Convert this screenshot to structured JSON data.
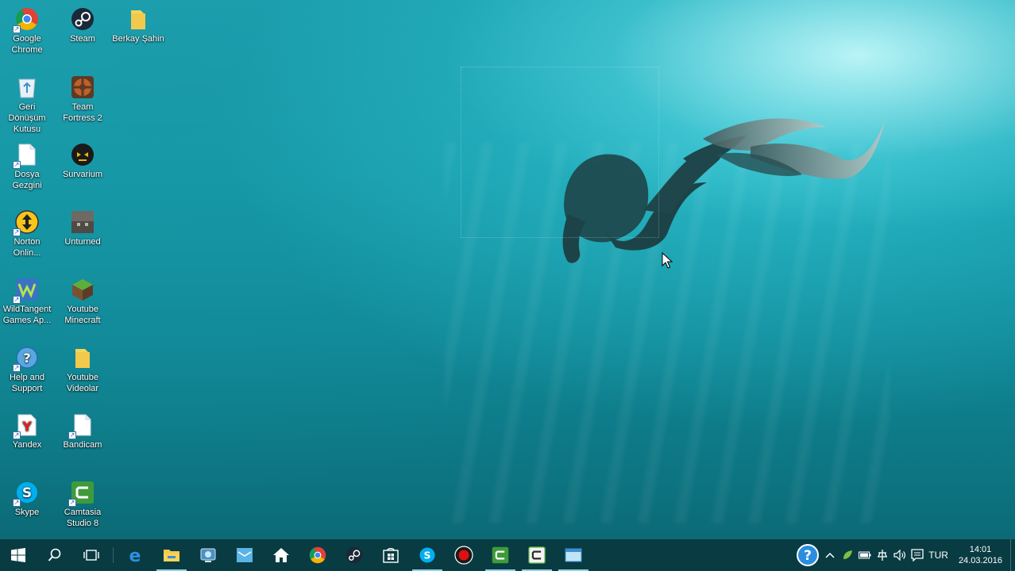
{
  "desktop": {
    "icons": [
      {
        "name": "google-chrome",
        "label": "Google Chrome",
        "icon": "chrome-icon"
      },
      {
        "name": "steam",
        "label": "Steam",
        "icon": "steam-icon"
      },
      {
        "name": "berkay-sahin",
        "label": "Berkay Şahin",
        "icon": "folder-icon"
      },
      {
        "name": "recycle-bin",
        "label": "Geri Dönüşüm Kutusu",
        "icon": "recycle-bin-icon"
      },
      {
        "name": "team-fortress-2",
        "label": "Team Fortress 2",
        "icon": "tf2-icon"
      },
      {
        "name": "file-explorer",
        "label": "Dosya Gezgini",
        "icon": "file-icon"
      },
      {
        "name": "survarium",
        "label": "Survarium",
        "icon": "survarium-icon"
      },
      {
        "name": "norton",
        "label": "Norton Onlin...",
        "icon": "norton-icon"
      },
      {
        "name": "unturned",
        "label": "Unturned",
        "icon": "unturned-icon"
      },
      {
        "name": "wildtangent",
        "label": "WildTangent Games Ap...",
        "icon": "wildtangent-icon"
      },
      {
        "name": "youtube-minecraft",
        "label": "Youtube Minecraft",
        "icon": "minecraft-icon"
      },
      {
        "name": "help-and-support",
        "label": "Help and Support",
        "icon": "help-icon"
      },
      {
        "name": "youtube-videolar",
        "label": "Youtube Videolar",
        "icon": "folder-icon"
      },
      {
        "name": "yandex",
        "label": "Yandex",
        "icon": "yandex-icon"
      },
      {
        "name": "bandicam",
        "label": "Bandicam",
        "icon": "file-icon"
      },
      {
        "name": "skype",
        "label": "Skype",
        "icon": "skype-icon"
      },
      {
        "name": "camtasia",
        "label": "Camtasia Studio 8",
        "icon": "camtasia-icon"
      }
    ]
  },
  "taskbar": {
    "apps": [
      {
        "name": "start",
        "icon": "windows-start-icon"
      },
      {
        "name": "search",
        "icon": "search-icon"
      },
      {
        "name": "task-view",
        "icon": "task-view-icon"
      },
      {
        "name": "edge",
        "icon": "edge-icon"
      },
      {
        "name": "file-explorer",
        "icon": "folder-icon"
      },
      {
        "name": "control-panel",
        "icon": "control-panel-icon"
      },
      {
        "name": "mail",
        "icon": "mail-icon"
      },
      {
        "name": "home",
        "icon": "home-icon"
      },
      {
        "name": "chrome",
        "icon": "chrome-icon"
      },
      {
        "name": "steam",
        "icon": "steam-icon"
      },
      {
        "name": "store",
        "icon": "store-icon"
      },
      {
        "name": "skype",
        "icon": "skype-icon"
      },
      {
        "name": "bandicam",
        "icon": "record-icon"
      },
      {
        "name": "camtasia-recorder",
        "icon": "camtasia-icon"
      },
      {
        "name": "camtasia-studio",
        "icon": "camtasia-studio-icon"
      },
      {
        "name": "window",
        "icon": "window-icon"
      }
    ],
    "tray": {
      "language": "TUR",
      "time": "14:01",
      "date": "24.03.2016"
    }
  },
  "colors": {
    "water": "#129aa8",
    "taskbar": "#0a373e",
    "active_indicator": "#8fd0e8"
  }
}
